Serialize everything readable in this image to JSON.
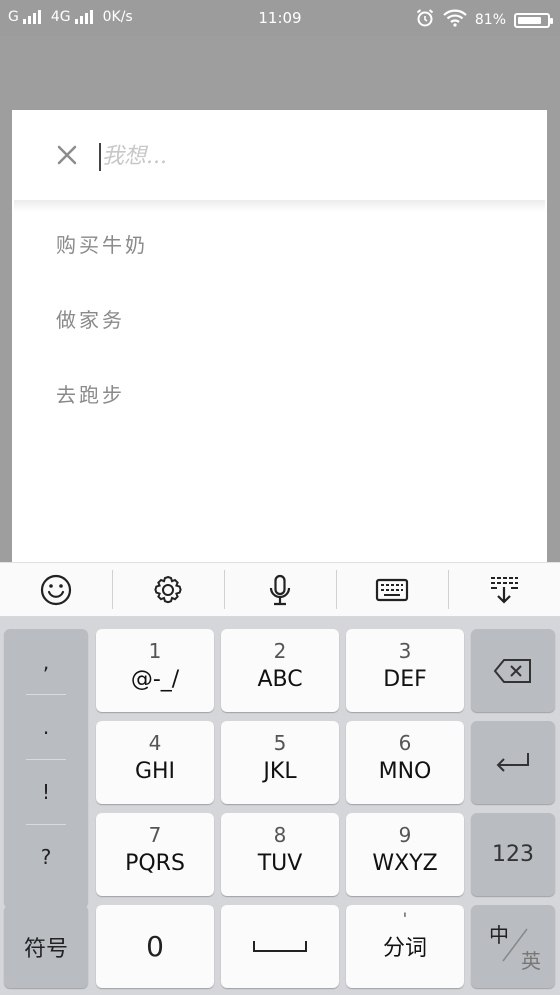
{
  "status_bar": {
    "carrier1": "G",
    "carrier2": "4G",
    "net_speed": "0K/s",
    "time": "11:09",
    "battery": "81%",
    "battery_level": 0.81
  },
  "search": {
    "placeholder": "我想..."
  },
  "suggestions": [
    "购买牛奶",
    "做家务",
    "去跑步"
  ],
  "keyboard": {
    "toolbar": [
      "emoji-icon",
      "settings-icon",
      "microphone-icon",
      "keyboard-icon",
      "collapse-keyboard-icon"
    ],
    "punctuation": [
      ",",
      ".",
      "!",
      "?"
    ],
    "keys": [
      {
        "num": "1",
        "letters": "@-_/"
      },
      {
        "num": "2",
        "letters": "ABC"
      },
      {
        "num": "3",
        "letters": "DEF"
      },
      {
        "num": "4",
        "letters": "GHI"
      },
      {
        "num": "5",
        "letters": "JKL"
      },
      {
        "num": "6",
        "letters": "MNO"
      },
      {
        "num": "7",
        "letters": "PQRS"
      },
      {
        "num": "8",
        "letters": "TUV"
      },
      {
        "num": "9",
        "letters": "WXYZ"
      }
    ],
    "symbol_label": "符号",
    "zero_label": "0",
    "segment_small": "'",
    "segment_label": "分词",
    "num_switch_label": "123",
    "lang_zh": "中",
    "lang_en": "英"
  }
}
